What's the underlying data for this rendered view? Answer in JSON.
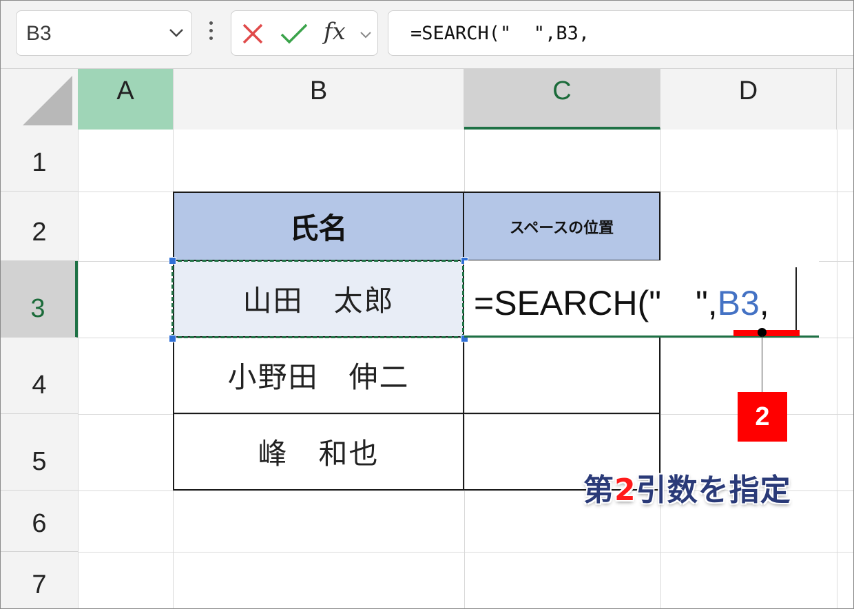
{
  "formula_bar": {
    "name_box": "B3",
    "cancel_icon": "x-icon",
    "enter_icon": "check-icon",
    "fx_label": "fx",
    "formula": "=SEARCH(\"  \",B3,"
  },
  "columns": [
    "A",
    "B",
    "C",
    "D"
  ],
  "rows": [
    "1",
    "2",
    "3",
    "4",
    "5",
    "6",
    "7"
  ],
  "table": {
    "header_name": "氏名",
    "header_position": "スペースの位置",
    "names": [
      "山田　太郎",
      "小野田　伸二",
      "峰　和也"
    ]
  },
  "edit_cell": {
    "prefix": "=SEARCH(\"　\",",
    "ref": "B3",
    "suffix": ","
  },
  "annotation": {
    "badge": "2",
    "callout_prefix": "第",
    "callout_number": "2",
    "callout_suffix": "引数を指定"
  },
  "colors": {
    "selection_green": "#1e7145",
    "header_fill": "#b4c6e7",
    "reference_blue": "#4472c4",
    "annotation_red": "#ff0000",
    "callout_navy": "#2a3a78"
  }
}
